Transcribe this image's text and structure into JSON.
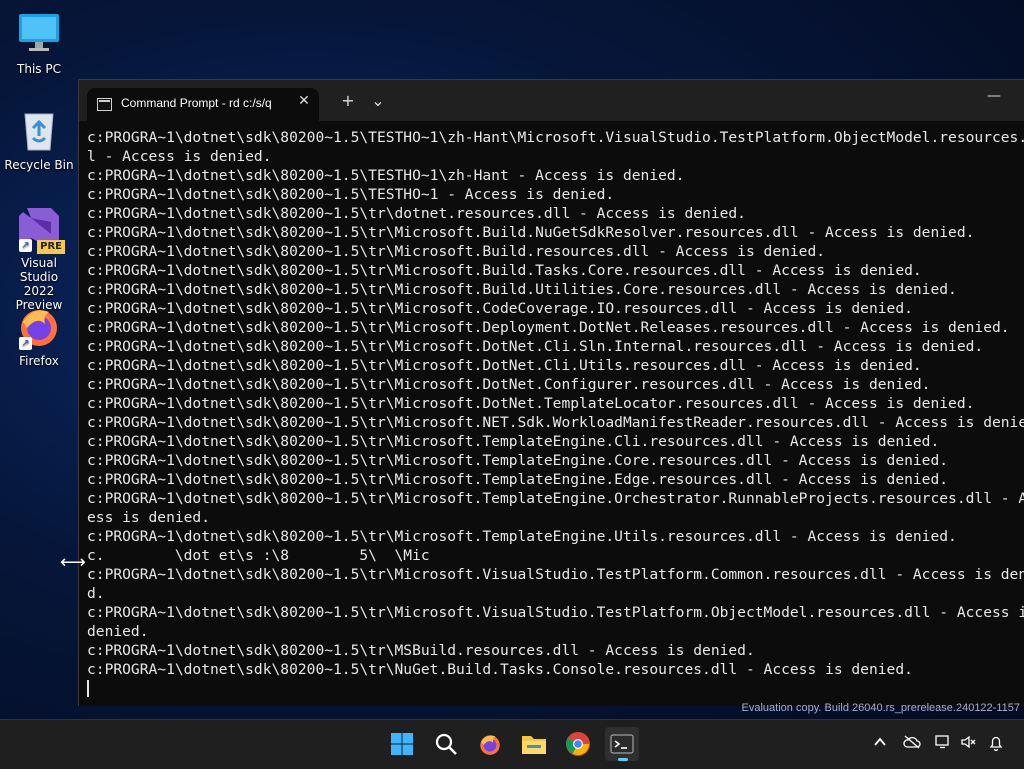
{
  "desktop": {
    "icons": [
      {
        "label": "This PC"
      },
      {
        "label": "Recycle Bin"
      },
      {
        "label": "Visual Studio\n2022 Preview",
        "badge": "PRE"
      },
      {
        "label": "Firefox"
      }
    ]
  },
  "terminal": {
    "tab_title": "Command Prompt - rd  c:/s/q",
    "new_tab_symbol": "+",
    "dropdown_symbol": "⌄",
    "close_symbol": "✕",
    "minimize_symbol": "—",
    "lines": [
      "c:PROGRA~1\\dotnet\\sdk\\80200~1.5\\TESTHO~1\\zh-Hant\\Microsoft.VisualStudio.TestPlatform.ObjectModel.resources.dl",
      "l - Access is denied.",
      "c:PROGRA~1\\dotnet\\sdk\\80200~1.5\\TESTHO~1\\zh-Hant - Access is denied.",
      "c:PROGRA~1\\dotnet\\sdk\\80200~1.5\\TESTHO~1 - Access is denied.",
      "c:PROGRA~1\\dotnet\\sdk\\80200~1.5\\tr\\dotnet.resources.dll - Access is denied.",
      "c:PROGRA~1\\dotnet\\sdk\\80200~1.5\\tr\\Microsoft.Build.NuGetSdkResolver.resources.dll - Access is denied.",
      "c:PROGRA~1\\dotnet\\sdk\\80200~1.5\\tr\\Microsoft.Build.resources.dll - Access is denied.",
      "c:PROGRA~1\\dotnet\\sdk\\80200~1.5\\tr\\Microsoft.Build.Tasks.Core.resources.dll - Access is denied.",
      "c:PROGRA~1\\dotnet\\sdk\\80200~1.5\\tr\\Microsoft.Build.Utilities.Core.resources.dll - Access is denied.",
      "c:PROGRA~1\\dotnet\\sdk\\80200~1.5\\tr\\Microsoft.CodeCoverage.IO.resources.dll - Access is denied.",
      "c:PROGRA~1\\dotnet\\sdk\\80200~1.5\\tr\\Microsoft.Deployment.DotNet.Releases.resources.dll - Access is denied.",
      "c:PROGRA~1\\dotnet\\sdk\\80200~1.5\\tr\\Microsoft.DotNet.Cli.Sln.Internal.resources.dll - Access is denied.",
      "c:PROGRA~1\\dotnet\\sdk\\80200~1.5\\tr\\Microsoft.DotNet.Cli.Utils.resources.dll - Access is denied.",
      "c:PROGRA~1\\dotnet\\sdk\\80200~1.5\\tr\\Microsoft.DotNet.Configurer.resources.dll - Access is denied.",
      "c:PROGRA~1\\dotnet\\sdk\\80200~1.5\\tr\\Microsoft.DotNet.TemplateLocator.resources.dll - Access is denied.",
      "c:PROGRA~1\\dotnet\\sdk\\80200~1.5\\tr\\Microsoft.NET.Sdk.WorkloadManifestReader.resources.dll - Access is denied.",
      "c:PROGRA~1\\dotnet\\sdk\\80200~1.5\\tr\\Microsoft.TemplateEngine.Cli.resources.dll - Access is denied.",
      "c:PROGRA~1\\dotnet\\sdk\\80200~1.5\\tr\\Microsoft.TemplateEngine.Core.resources.dll - Access is denied.",
      "c:PROGRA~1\\dotnet\\sdk\\80200~1.5\\tr\\Microsoft.TemplateEngine.Edge.resources.dll - Access is denied.",
      "c:PROGRA~1\\dotnet\\sdk\\80200~1.5\\tr\\Microsoft.TemplateEngine.Orchestrator.RunnableProjects.resources.dll - Acc",
      "ess is denied.",
      "c:PROGRA~1\\dotnet\\sdk\\80200~1.5\\tr\\Microsoft.TemplateEngine.Utils.resources.dll - Access is denied.",
      "c.        \\dot et\\s :\\8        5\\  \\Mic",
      "c:PROGRA~1\\dotnet\\sdk\\80200~1.5\\tr\\Microsoft.VisualStudio.TestPlatform.Common.resources.dll - Access is denie",
      "d.",
      "c:PROGRA~1\\dotnet\\sdk\\80200~1.5\\tr\\Microsoft.VisualStudio.TestPlatform.ObjectModel.resources.dll - Access is",
      "denied.",
      "c:PROGRA~1\\dotnet\\sdk\\80200~1.5\\tr\\MSBuild.resources.dll - Access is denied.",
      "c:PROGRA~1\\dotnet\\sdk\\80200~1.5\\tr\\NuGet.Build.Tasks.Console.resources.dll - Access is denied."
    ]
  },
  "watermark": "Evaluation copy. Build 26040.rs_prerelease.240122-1157",
  "taskbar": {
    "apps": [
      "start",
      "search",
      "firefox",
      "file-explorer",
      "chrome",
      "terminal"
    ],
    "active_app": "terminal"
  },
  "colors": {
    "terminal_bg": "#0c0c0c",
    "titlebar": "#202020",
    "taskbar": "#1f1f1f",
    "accent": "#60cdff"
  }
}
